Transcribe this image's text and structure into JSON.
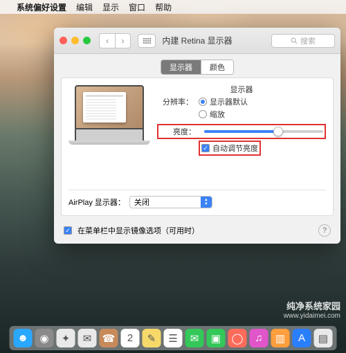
{
  "menubar": {
    "app": "系统偏好设置",
    "items": [
      "编辑",
      "显示",
      "窗口",
      "帮助"
    ]
  },
  "window": {
    "title": "内建 Retina 显示器",
    "search_placeholder": "搜索",
    "tabs": {
      "display": "显示器",
      "color": "颜色"
    },
    "section_heading": "显示器",
    "resolution_label": "分辨率：",
    "resolution_default": "显示器默认",
    "resolution_scaled": "缩放",
    "brightness_label": "亮度：",
    "brightness_value": 62,
    "auto_brightness": "自动调节亮度",
    "airplay_label": "AirPlay 显示器：",
    "airplay_value": "关闭",
    "mirror_checkbox": "在菜单栏中显示镜像选项（可用时）"
  },
  "watermark": {
    "line1": "纯净系统家园",
    "line2": "www.yidaimei.com"
  },
  "dock": {
    "items": [
      {
        "name": "finder",
        "bg": "#2aa7ff",
        "glyph": "☻"
      },
      {
        "name": "launchpad",
        "bg": "#8a8a8a",
        "glyph": "◉"
      },
      {
        "name": "safari",
        "bg": "#e9e9e9",
        "glyph": "✦"
      },
      {
        "name": "mail",
        "bg": "#e9e9e9",
        "glyph": "✉"
      },
      {
        "name": "contacts",
        "bg": "#c78a5a",
        "glyph": "☎"
      },
      {
        "name": "calendar",
        "bg": "#fff",
        "glyph": "2"
      },
      {
        "name": "notes",
        "bg": "#f7d96a",
        "glyph": "✎"
      },
      {
        "name": "reminders",
        "bg": "#fff",
        "glyph": "☰"
      },
      {
        "name": "messages",
        "bg": "#34c759",
        "glyph": "✉"
      },
      {
        "name": "facetime",
        "bg": "#34c759",
        "glyph": "▣"
      },
      {
        "name": "photobooth",
        "bg": "#ff6b5b",
        "glyph": "◯"
      },
      {
        "name": "itunes",
        "bg": "#e055c9",
        "glyph": "♫"
      },
      {
        "name": "ibooks",
        "bg": "#ff9e3d",
        "glyph": "▥"
      },
      {
        "name": "appstore",
        "bg": "#2a7fff",
        "glyph": "A"
      },
      {
        "name": "preview",
        "bg": "#e9e9e9",
        "glyph": "▤"
      }
    ]
  }
}
